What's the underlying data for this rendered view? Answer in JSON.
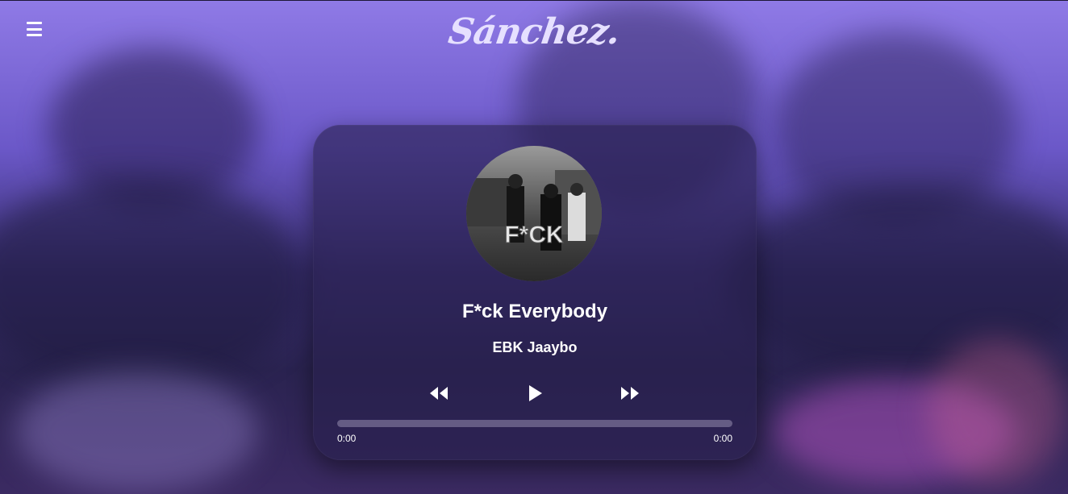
{
  "header": {
    "logo_text": "Sánchez.",
    "menu_icon": "hamburger-menu-icon"
  },
  "player": {
    "cover_icon": "album-cover",
    "cover_text": "F*CK",
    "title": "F*ck Everybody",
    "artist": "EBK Jaaybo",
    "controls": {
      "previous_icon": "rewind-icon",
      "play_icon": "play-icon",
      "next_icon": "fast-forward-icon"
    },
    "progress": 0,
    "current_time": "0:00",
    "duration": "0:00"
  },
  "colors": {
    "accent": "#ffffff",
    "card_bg": "#28204e",
    "background_top": "#8f7ae6",
    "background_bottom": "#2a2350"
  }
}
